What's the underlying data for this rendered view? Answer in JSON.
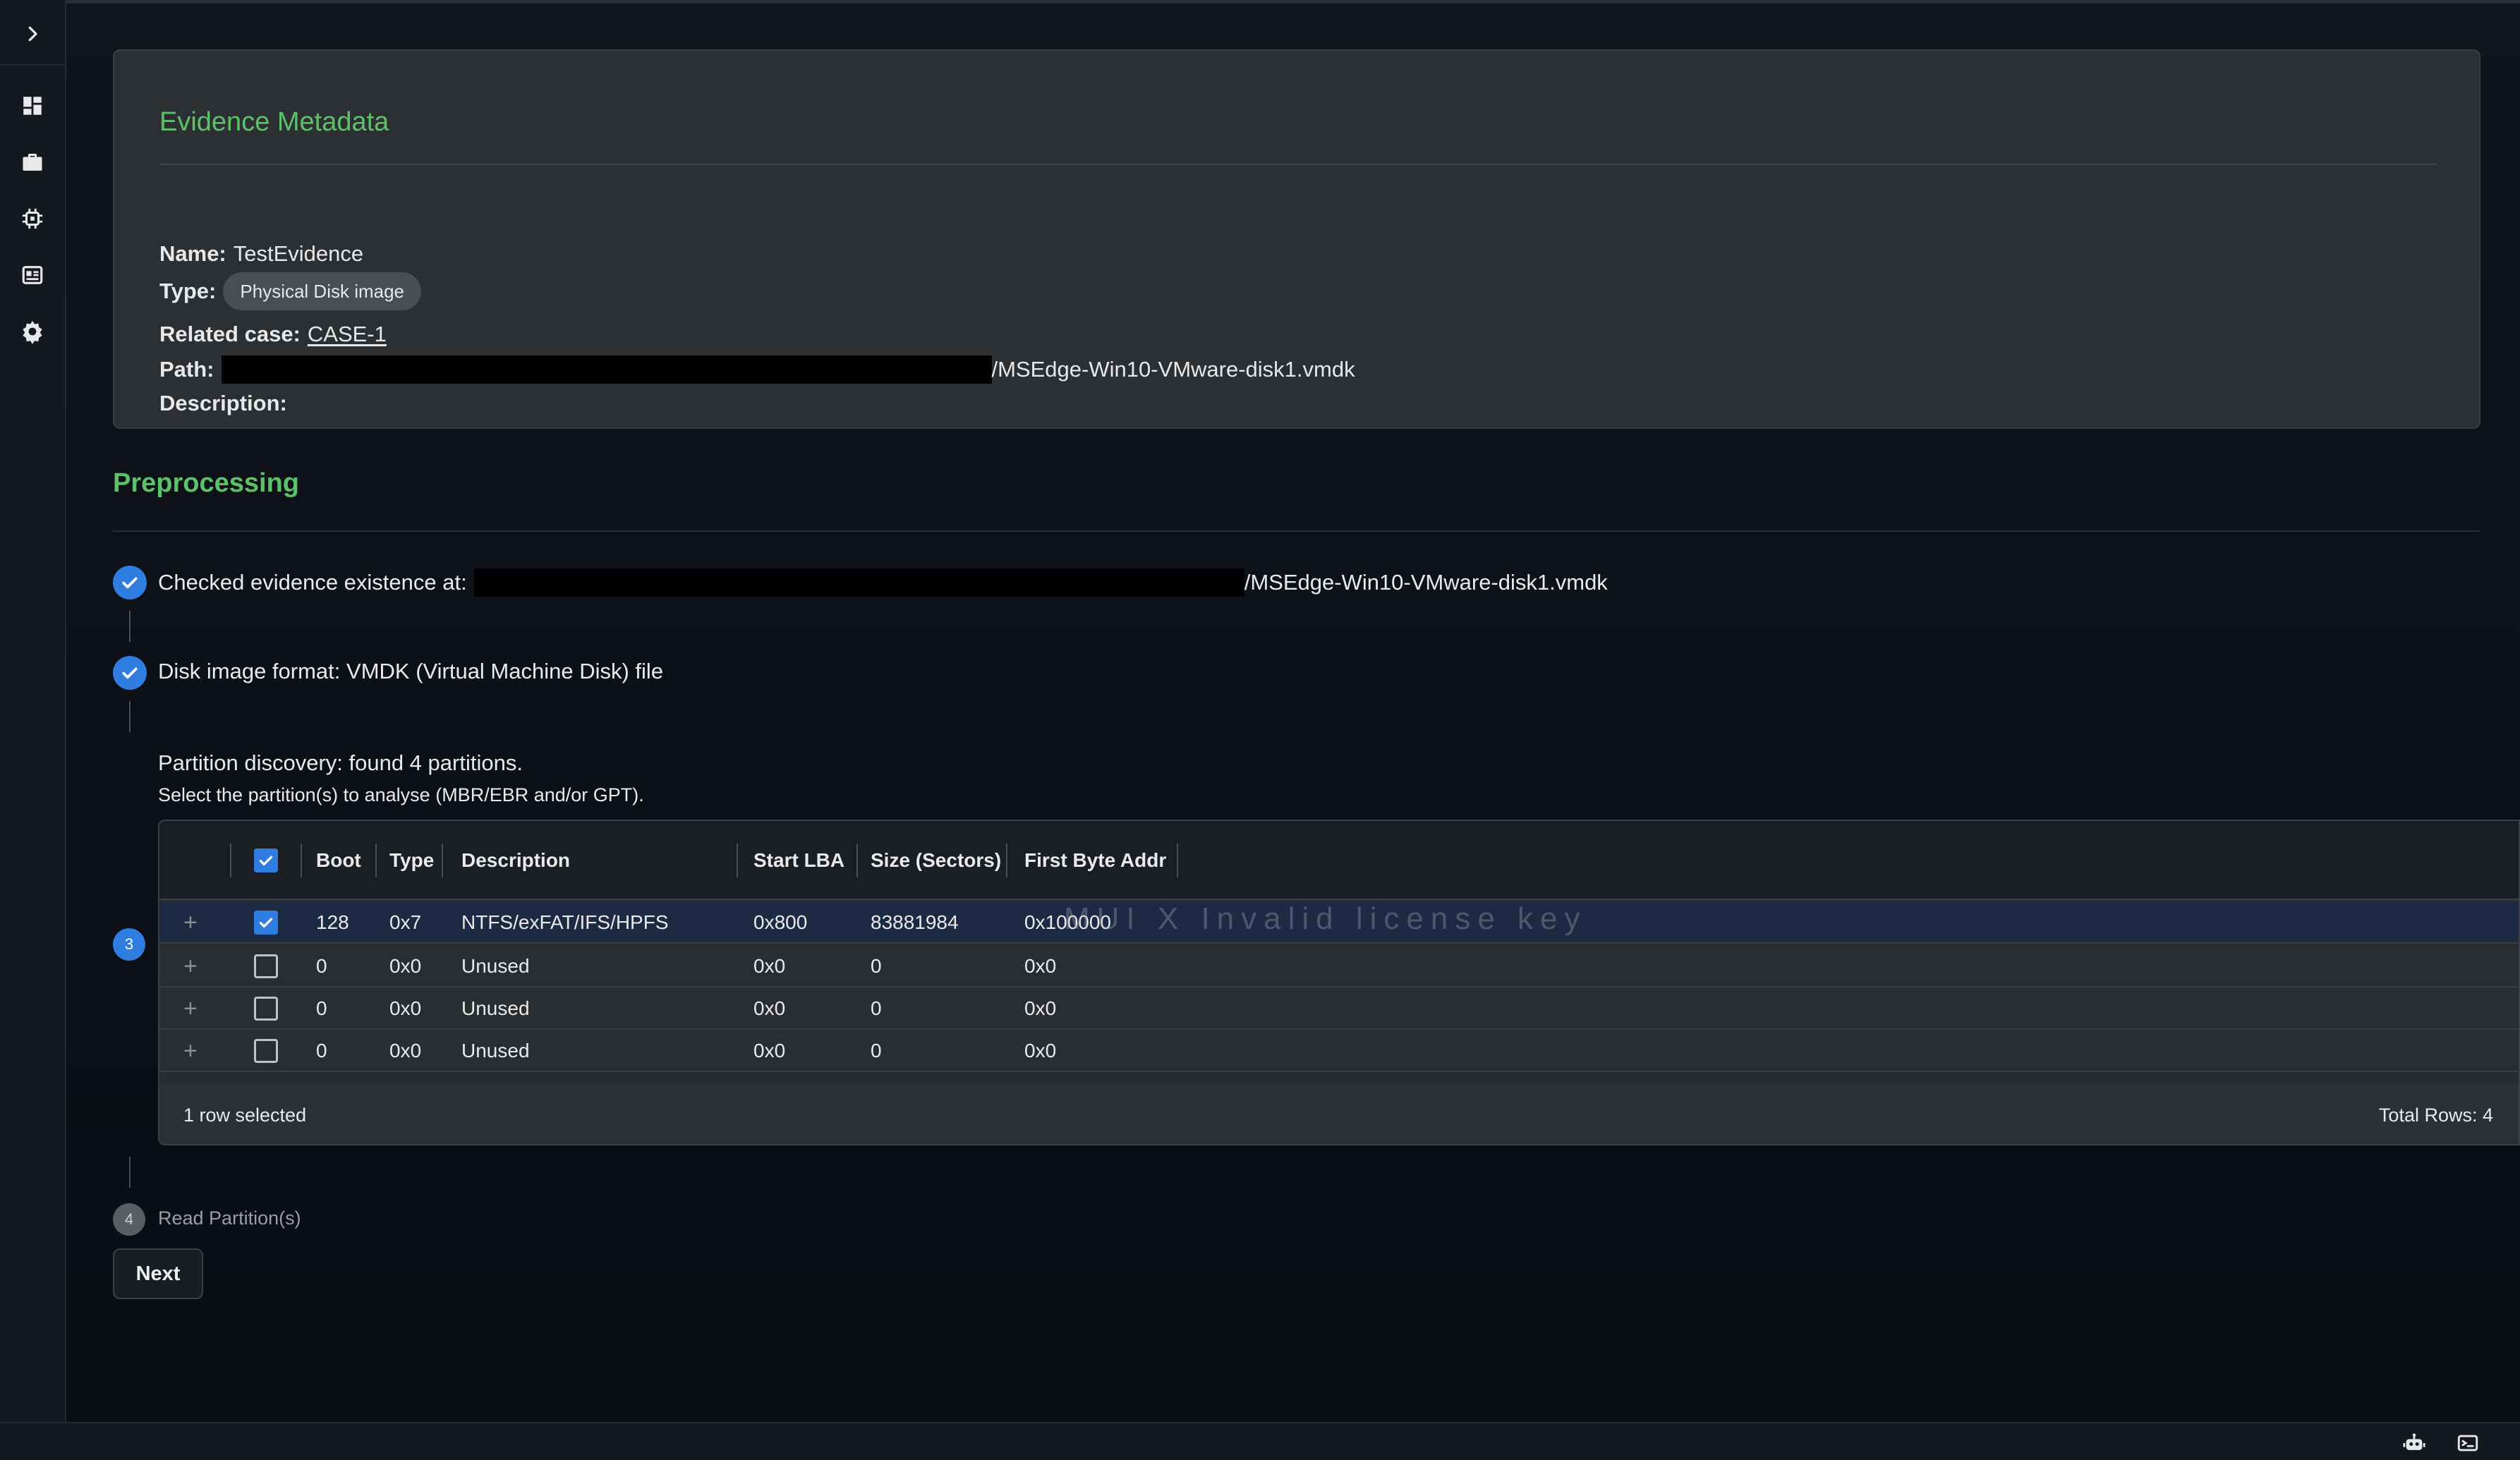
{
  "sidebar": {
    "toggle_icon": "chevron-right-icon",
    "items": [
      {
        "icon": "dashboard-icon"
      },
      {
        "icon": "briefcase-icon"
      },
      {
        "icon": "chip-icon"
      },
      {
        "icon": "newspaper-icon"
      },
      {
        "icon": "gear-icon"
      }
    ]
  },
  "evidence": {
    "title": "Evidence Metadata",
    "name_label": "Name:",
    "name_value": "TestEvidence",
    "type_label": "Type:",
    "type_value": "Physical Disk image",
    "case_label": "Related case:",
    "case_value": "CASE-1",
    "path_label": "Path:",
    "path_value": "/MSEdge-Win10-VMware-disk1.vmdk",
    "description_label": "Description:",
    "description_value": ""
  },
  "preprocessing": {
    "title": "Preprocessing",
    "step1_label": "Checked evidence existence at:",
    "step1_path": "/MSEdge-Win10-VMware-disk1.vmdk",
    "step2_label": "Disk image format: VMDK (Virtual Machine Disk) file",
    "step3_number": "3",
    "step3_label": "Partition discovery: found 4 partitions.",
    "step3_sub": "Select the partition(s) to analyse (MBR/EBR and/or GPT).",
    "step4_number": "4",
    "step4_label": "Read Partition(s)",
    "next_label": "Next"
  },
  "partitions": {
    "columns": [
      "Boot",
      "Type",
      "Description",
      "Start LBA",
      "Size (Sectors)",
      "First Byte Addr"
    ],
    "rows": [
      {
        "selected": true,
        "boot": "128",
        "type": "0x7",
        "description": "NTFS/exFAT/IFS/HPFS",
        "start_lba": "0x800",
        "size": "83881984",
        "first_byte": "0x100000"
      },
      {
        "selected": false,
        "boot": "0",
        "type": "0x0",
        "description": "Unused",
        "start_lba": "0x0",
        "size": "0",
        "first_byte": "0x0"
      },
      {
        "selected": false,
        "boot": "0",
        "type": "0x0",
        "description": "Unused",
        "start_lba": "0x0",
        "size": "0",
        "first_byte": "0x0"
      },
      {
        "selected": false,
        "boot": "0",
        "type": "0x0",
        "description": "Unused",
        "start_lba": "0x0",
        "size": "0",
        "first_byte": "0x0"
      }
    ],
    "footer_selected": "1 row selected",
    "footer_total": "Total Rows: 4",
    "watermark": "MUI X Invalid license key"
  },
  "bottombar": {
    "icons": [
      "robot-icon",
      "terminal-icon"
    ]
  },
  "colors": {
    "accent_green": "#5bc26a",
    "accent_blue": "#2f7de1",
    "selected_row": "#1d2a44"
  }
}
